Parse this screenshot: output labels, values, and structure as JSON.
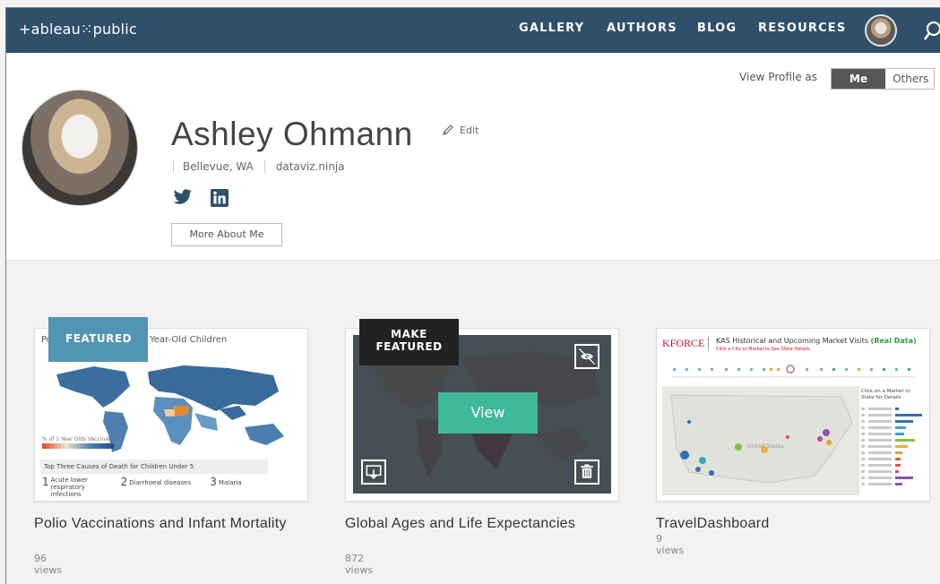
{
  "nav": {
    "logo": "+ableau⁙public",
    "links": [
      "GALLERY",
      "AUTHORS",
      "BLOG",
      "RESOURCES"
    ]
  },
  "profile": {
    "view_as_label": "View Profile as",
    "view_as_options": [
      "Me",
      "Others"
    ],
    "view_as_selected": "Me",
    "name": "Ashley Ohmann",
    "edit_label": "Edit",
    "location": "Bellevue, WA",
    "website": "dataviz.ninja",
    "socials": [
      "twitter-icon",
      "linkedin-icon"
    ],
    "more_button": "More About Me"
  },
  "cards": [
    {
      "title": "Polio Vaccinations and Infant Mortality",
      "views": "96 views",
      "badge": "FEATURED",
      "thumb": {
        "title_left": "Po",
        "title_right": "Year-Old Children",
        "legend": "% of 1 Year Olds Vaccinated",
        "section": "Top Three Causes of Death for Children Under 5",
        "causes": [
          {
            "n": "1",
            "label": "Acute lower respiratory infections"
          },
          {
            "n": "2",
            "label": "Diarrhoeal diseases"
          },
          {
            "n": "3",
            "label": "Malaria"
          }
        ]
      }
    },
    {
      "title": "Global Ages and Life Expectancies",
      "views": "872 views",
      "badge_line1": "MAKE",
      "badge_line2": "FEATURED",
      "view_button": "View"
    },
    {
      "title": "TravelDashboard",
      "views": "9 views",
      "thumb": {
        "brand": "KFORCE",
        "heading": "KAS Historical and Upcoming Market Visits",
        "heading_accent": "(Real Data)",
        "subtitle": "Click a City or Market to See State Details",
        "side_heading": "Click on a Market or State for Details",
        "map_label": "United States"
      }
    }
  ],
  "colors": {
    "nav_bg": "#2f4f6a",
    "featured_badge": "#5294b3",
    "view_button": "#3fb99a",
    "kforce_red": "#c8102e",
    "accent_green": "#2e9e48"
  }
}
